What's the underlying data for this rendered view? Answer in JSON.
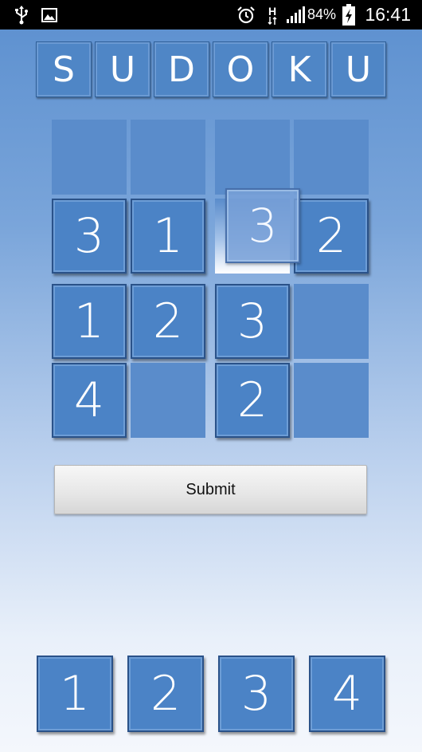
{
  "status_bar": {
    "time": "16:41",
    "battery_percent": "84%",
    "network_type": "H",
    "icons": [
      "usb-icon",
      "image-icon",
      "alarm-icon",
      "network-h-icon",
      "signal-icon",
      "battery-charging-icon"
    ]
  },
  "title": {
    "letters": [
      "S",
      "U",
      "D",
      "O",
      "K",
      "U"
    ]
  },
  "board": {
    "rows": [
      [
        "",
        "",
        "",
        ""
      ],
      [
        "3",
        "1",
        "",
        "2"
      ],
      [
        "1",
        "2",
        "3",
        ""
      ],
      [
        "4",
        "",
        "2",
        ""
      ]
    ],
    "highlighted_cell": {
      "row": 1,
      "col": 2
    },
    "dragging_value": "3"
  },
  "submit": {
    "label": "Submit"
  },
  "palette": {
    "numbers": [
      "1",
      "2",
      "3",
      "4"
    ]
  },
  "colors": {
    "tile": "#4b83c6",
    "tile_border": "#2a5289",
    "empty_cell": "#5a8ccb",
    "background_top": "#5b8fcf",
    "background_bottom": "#f4f7fc"
  }
}
